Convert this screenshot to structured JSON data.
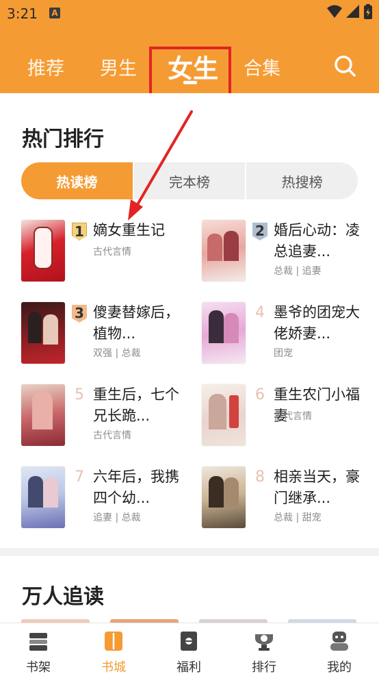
{
  "status": {
    "time": "3:21",
    "notif_letter": "A"
  },
  "topnav": {
    "tabs": [
      {
        "label": "推荐"
      },
      {
        "label": "男生"
      },
      {
        "label": "女生"
      },
      {
        "label": "合集"
      }
    ],
    "active_tab": "女生",
    "search_icon": "search-icon"
  },
  "hot": {
    "title": "热门排行",
    "segments": [
      "热读榜",
      "完本榜",
      "热搜榜"
    ],
    "active_segment": "热读榜",
    "books": [
      {
        "rank": "1",
        "title": "嫡女重生记",
        "tags": "古代言情"
      },
      {
        "rank": "2",
        "title": "婚后心动：凌总追妻...",
        "tags": "总裁 | 追妻"
      },
      {
        "rank": "3",
        "title": "傻妻替嫁后，植物...",
        "tags": "双强 | 总裁"
      },
      {
        "rank": "4",
        "title": "墨爷的团宠大佬娇妻...",
        "tags": "团宠"
      },
      {
        "rank": "5",
        "title": "重生后，七个兄长跪...",
        "tags": "古代言情"
      },
      {
        "rank": "6",
        "title": "重生农门小福妻",
        "tags": "古代言情"
      },
      {
        "rank": "7",
        "title": "六年后，我携四个幼...",
        "tags": "追妻 | 总裁"
      },
      {
        "rank": "8",
        "title": "相亲当天，豪门继承...",
        "tags": "总裁 | 甜宠"
      }
    ]
  },
  "section2": {
    "title": "万人追读"
  },
  "bottom_nav": {
    "items": [
      {
        "label": "书架"
      },
      {
        "label": "书城"
      },
      {
        "label": "福利"
      },
      {
        "label": "排行"
      },
      {
        "label": "我的"
      }
    ],
    "active": "书城"
  },
  "colors": {
    "accent": "#f59b34",
    "annotation": "#e32323"
  }
}
